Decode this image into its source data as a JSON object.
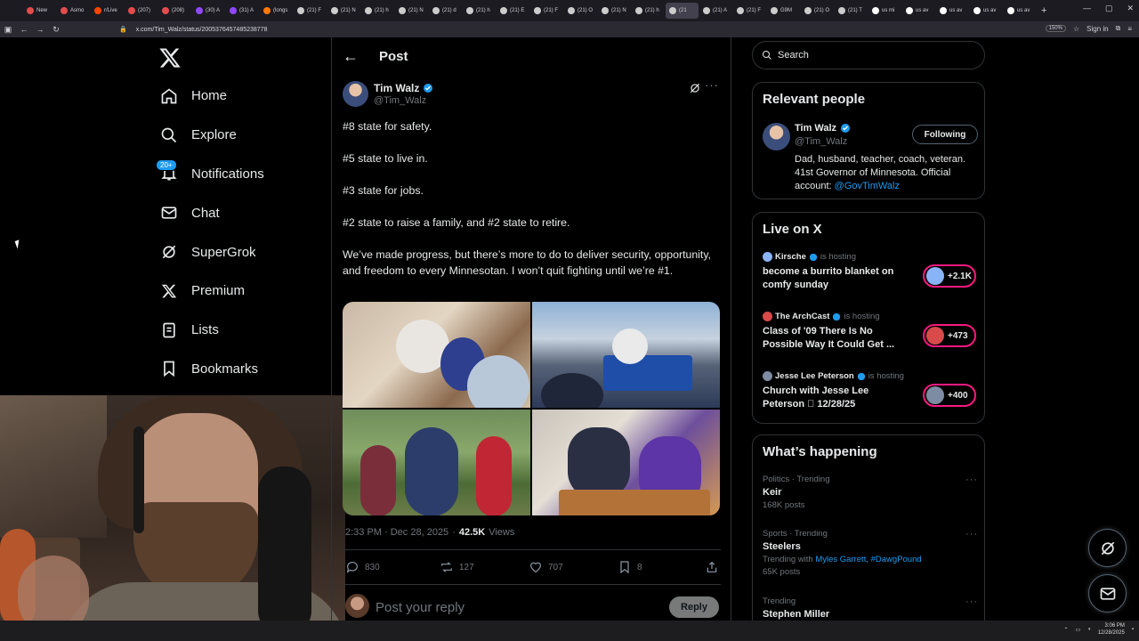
{
  "browser": {
    "tabs": [
      {
        "label": "New",
        "color": "#e34c4c"
      },
      {
        "label": "Asmo",
        "color": "#e34c4c"
      },
      {
        "label": "r/Live",
        "color": "#ff4500"
      },
      {
        "label": "(207)",
        "color": "#e34c4c"
      },
      {
        "label": "(208)",
        "color": "#e34c4c"
      },
      {
        "label": "(30) A",
        "color": "#9146ff"
      },
      {
        "label": "(31) A",
        "color": "#9146ff"
      },
      {
        "label": "(longs",
        "color": "#ff7a00"
      },
      {
        "label": "(21) F",
        "color": "#cccccc"
      },
      {
        "label": "(21) N",
        "color": "#cccccc"
      },
      {
        "label": "(21) h",
        "color": "#cccccc"
      },
      {
        "label": "(21) N",
        "color": "#cccccc"
      },
      {
        "label": "(21) d",
        "color": "#cccccc"
      },
      {
        "label": "(21) h",
        "color": "#cccccc"
      },
      {
        "label": "(21) E",
        "color": "#cccccc"
      },
      {
        "label": "(21) F",
        "color": "#cccccc"
      },
      {
        "label": "(21) O",
        "color": "#cccccc"
      },
      {
        "label": "(21) N",
        "color": "#cccccc"
      },
      {
        "label": "(21) h",
        "color": "#cccccc"
      },
      {
        "label": "(21",
        "color": "#cccccc",
        "active": true
      },
      {
        "label": "(21) A",
        "color": "#cccccc"
      },
      {
        "label": "(21) F",
        "color": "#cccccc"
      },
      {
        "label": "G9M",
        "color": "#cccccc"
      },
      {
        "label": "(21) O",
        "color": "#cccccc"
      },
      {
        "label": "(21) T",
        "color": "#cccccc"
      },
      {
        "label": "us mi",
        "color": "#ffffff"
      },
      {
        "label": "us av",
        "color": "#ffffff"
      },
      {
        "label": "us av",
        "color": "#ffffff"
      },
      {
        "label": "us av",
        "color": "#ffffff"
      },
      {
        "label": "us av",
        "color": "#ffffff"
      }
    ],
    "url": "x.com/Tim_Walz/status/2005376457485238778",
    "zoom": "150%",
    "account": "Sign in"
  },
  "nav": {
    "items": [
      {
        "label": "Home",
        "icon": "home-icon"
      },
      {
        "label": "Explore",
        "icon": "search-icon"
      },
      {
        "label": "Notifications",
        "icon": "bell-icon",
        "badge": "20+"
      },
      {
        "label": "Chat",
        "icon": "mail-icon"
      },
      {
        "label": "SuperGrok",
        "icon": "grok-icon"
      },
      {
        "label": "Premium",
        "icon": "x-logo-icon"
      },
      {
        "label": "Lists",
        "icon": "list-icon"
      },
      {
        "label": "Bookmarks",
        "icon": "bookmark-icon"
      }
    ]
  },
  "header": {
    "title": "Post"
  },
  "post": {
    "author": "Tim Walz",
    "handle": "@Tim_Walz",
    "paragraphs": [
      "#8 state for safety.",
      "#5 state to live in.",
      "#3 state for jobs.",
      "#2 state to raise a family, and #2 state to retire.",
      "We’ve made progress, but there’s more to do to deliver security, opportunity, and freedom to every Minnesotan. I won’t quit fighting until we’re #1."
    ],
    "time": "2:33 PM · Dec 28, 2025",
    "views_count": "42.5K",
    "views_label": "Views",
    "replies": "830",
    "reposts": "127",
    "likes": "707",
    "bookmarks": "8",
    "reply_placeholder": "Post your reply",
    "reply_button": "Reply"
  },
  "sidebar": {
    "search_placeholder": "Search",
    "relevant_title": "Relevant people",
    "person": {
      "name": "Tim Walz",
      "handle": "@Tim_Walz",
      "follow_label": "Following",
      "bio": "Dad, husband, teacher, coach, veteran. 41st Governor of Minnesota. Official account:",
      "bio_link": "@GovTimWalz"
    },
    "live_title": "Live on X",
    "live": [
      {
        "host": "Kirsche",
        "status": "is hosting",
        "title": "become a burrito blanket on comfy sunday",
        "count": "+2.1K",
        "color": "#8ab4f8"
      },
      {
        "host": "The ArchCast",
        "status": "is hosting",
        "title": "Class of '09 There Is No Possible Way It Could Get ...",
        "count": "+473",
        "color": "#d94b4b"
      },
      {
        "host": "Jesse Lee Peterson",
        "status": "is hosting",
        "title": "Church with Jesse Lee Peterson 🏾 12/28/25",
        "count": "+400",
        "color": "#7d8ca3"
      }
    ],
    "happening_title": "What’s happening",
    "trends": [
      {
        "category": "Politics · Trending",
        "title": "Keir",
        "count": "168K posts"
      },
      {
        "category": "Sports · Trending",
        "title": "Steelers",
        "with_label": "Trending with",
        "with_links": "Myles Garrett, #DawgPound",
        "count": "65K posts"
      },
      {
        "category": "Trending",
        "title": "Stephen Miller"
      }
    ]
  },
  "taskbar": {
    "time": "3:06 PM",
    "date": "12/28/2025"
  }
}
